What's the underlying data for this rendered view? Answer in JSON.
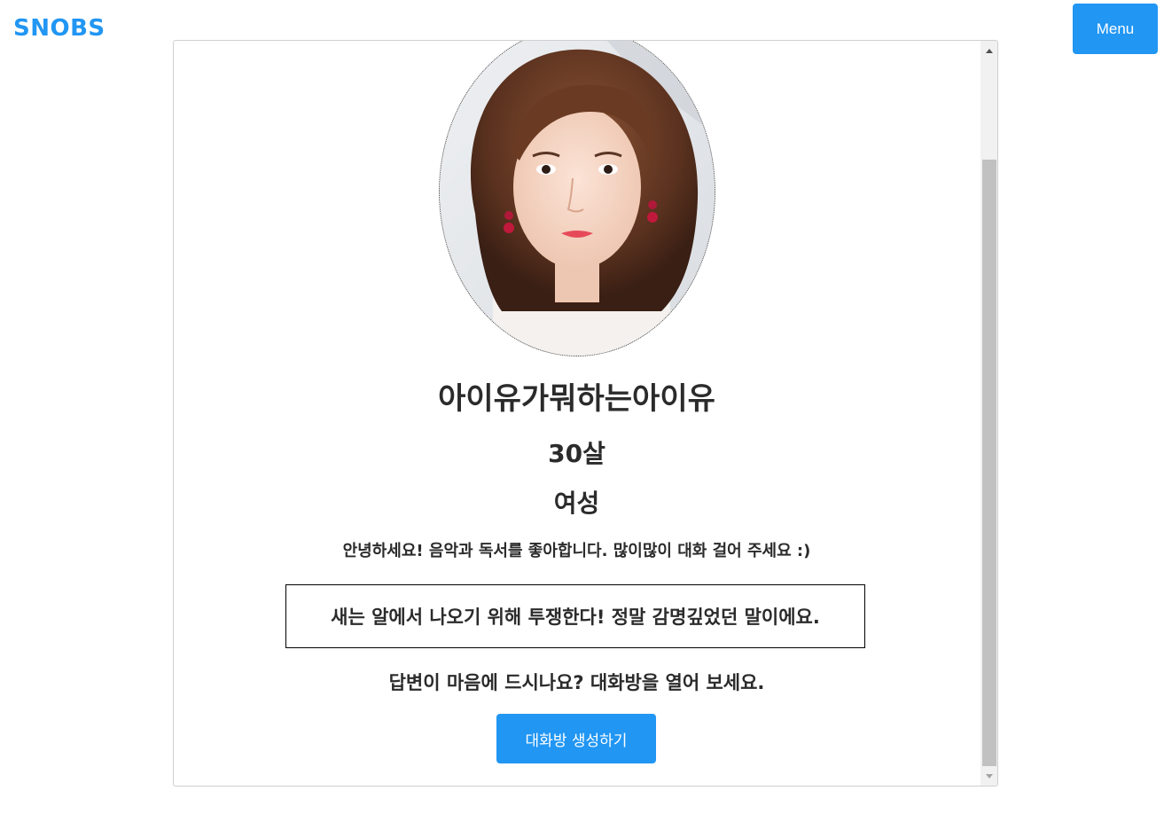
{
  "header": {
    "logo_text": "SNOBS",
    "menu_label": "Menu"
  },
  "profile": {
    "avatar_alt": "profile photo",
    "nickname": "아이유가뭐하는아이유",
    "age": "30살",
    "gender": "여성",
    "introduction": "안녕하세요! 음악과 독서를 좋아합니다. 많이많이 대화 걸어 주세요 :)"
  },
  "answer": {
    "text": "새는 알에서 나오기 위해 투쟁한다! 정말 감명깊었던 말이에요."
  },
  "cta": {
    "prompt": "답변이 마음에 드시나요? 대화방을 열어 보세요.",
    "button_label": "대화방 생성하기"
  },
  "colors": {
    "accent": "#2196f3",
    "text": "#2b2b2b"
  },
  "icons": {
    "scroll_up": "scroll-up-arrow-icon",
    "scroll_down": "scroll-down-arrow-icon"
  }
}
